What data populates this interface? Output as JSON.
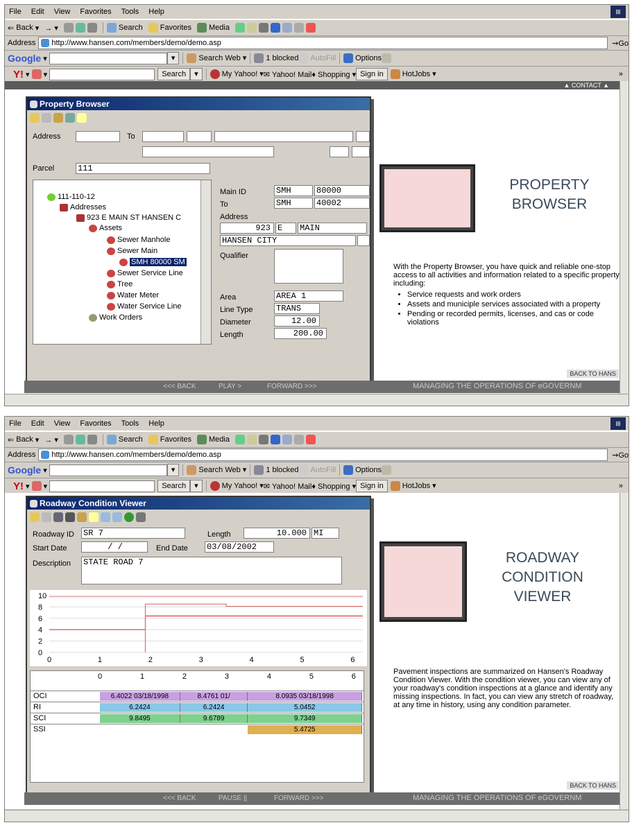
{
  "menu": [
    "File",
    "Edit",
    "View",
    "Favorites",
    "Tools",
    "Help"
  ],
  "toolbar": {
    "back": "Back",
    "search": "Search",
    "favorites": "Favorites",
    "media": "Media"
  },
  "address": {
    "label": "Address",
    "url": "http://www.hansen.com/members/demo/demo.asp",
    "go": "Go"
  },
  "google": {
    "brand": "Google",
    "search_web": "Search Web",
    "blocked": "1 blocked",
    "autofill": "AutoFill",
    "options": "Options"
  },
  "yahoo": {
    "search": "Search",
    "my_yahoo": "My Yahoo!",
    "mail": "Yahoo! Mail",
    "shopping": "Shopping",
    "sign_in": "Sign in",
    "hotjobs": "HotJobs"
  },
  "strip": {
    "contact": "▲ CONTACT ▲",
    "back": "<<< BACK",
    "play": "PLAY >",
    "pause": "PAUSE ||",
    "forward": "FORWARD >>>",
    "managing": "MANAGING THE OPERATIONS OF eGOVERNM",
    "back_to": "BACK TO HANS"
  },
  "property": {
    "title": "Property Browser",
    "address_label": "Address",
    "to_label": "To",
    "parcel_label": "Parcel",
    "parcel_value": "111",
    "tree": [
      "111-110-12",
      "Addresses",
      "923 E MAIN ST HANSEN C",
      "Assets",
      "Sewer Manhole",
      "Sewer Main",
      "SMH 80000 SM",
      "Sewer Service Line",
      "Tree",
      "Water Meter",
      "Water Service Line",
      "Work Orders"
    ],
    "main_id_label": "Main ID",
    "main_id_a": "SMH",
    "main_id_b": "80000",
    "to2_label": "To",
    "to_a": "SMH",
    "to_b": "40002",
    "addr_label": "Address",
    "addr_num": "923",
    "addr_dir": "E",
    "addr_street": "MAIN",
    "city": "HANSEN CITY",
    "qualifier_label": "Qualifier",
    "area_label": "Area",
    "area": "AREA 1",
    "linetype_label": "Line Type",
    "linetype": "TRANS",
    "diameter_label": "Diameter",
    "diameter": "12.00",
    "length_label": "Length",
    "length": "200.00",
    "heading_1": "PROPERTY",
    "heading_2": "BROWSER",
    "intro": "With the Property Browser, you have quick and reliable one-stop access to all activities and information related to a specific property, including:",
    "bullets": [
      "Service requests and work orders",
      "Assets and municiple services associated with a property",
      "Pending or recorded permits, licenses, and cas or code violations"
    ]
  },
  "roadway": {
    "title": "Roadway Condition Viewer",
    "rid_label": "Roadway ID",
    "rid": "SR 7",
    "length_label": "Length",
    "length": "10.000",
    "unit": "MI",
    "start_label": "Start Date",
    "start": "/ /",
    "end_label": "End Date",
    "end": "03/08/2002",
    "desc_label": "Description",
    "desc": "STATE ROAD 7",
    "heading_1": "ROADWAY",
    "heading_2": "CONDITION",
    "heading_3": "VIEWER",
    "text": "Pavement inspections are summarized on Hansen's Roadway Condition Viewer. With the condition viewer, you can view any of your roadway's condition inspections at a glance and identify any missing inspections. In fact, you can view any stretch of roadway, at any time in history, using any condition parameter.",
    "rows": [
      {
        "name": "OCI",
        "cells": [
          {
            "t": "6.4022 03/18/1998",
            "a": 0,
            "b": 1.9,
            "c": "#c8a0e0"
          },
          {
            "t": "8.4761 01/",
            "a": 1.9,
            "b": 3.5,
            "c": "#c8a0e0"
          },
          {
            "t": "8.0935 03/18/1998",
            "a": 3.5,
            "b": 6.2,
            "c": "#c8a0e0"
          }
        ]
      },
      {
        "name": "RI",
        "cells": [
          {
            "t": "6.2424",
            "a": 0,
            "b": 1.9,
            "c": "#88c8e8"
          },
          {
            "t": "6.2424",
            "a": 1.9,
            "b": 3.5,
            "c": "#88c8e8"
          },
          {
            "t": "5.0452",
            "a": 3.5,
            "b": 6.2,
            "c": "#88c8e8"
          }
        ]
      },
      {
        "name": "SCI",
        "cells": [
          {
            "t": "9.8495",
            "a": 0,
            "b": 1.9,
            "c": "#80d090"
          },
          {
            "t": "9.6789",
            "a": 1.9,
            "b": 3.5,
            "c": "#80d090"
          },
          {
            "t": "9.7349",
            "a": 3.5,
            "b": 6.2,
            "c": "#80d090"
          }
        ]
      },
      {
        "name": "SSI",
        "cells": [
          {
            "t": "5.4725",
            "a": 3.5,
            "b": 6.2,
            "c": "#e0b050"
          }
        ]
      }
    ]
  },
  "chart_data": {
    "type": "line",
    "x_ticks": [
      0,
      1,
      2,
      3,
      4,
      5,
      6
    ],
    "y_ticks": [
      0,
      2,
      4,
      6,
      8,
      10
    ],
    "xlim": [
      0,
      6.2
    ],
    "ylim": [
      0,
      10
    ],
    "series": [
      {
        "x": [
          0,
          1.9,
          1.9,
          6.2
        ],
        "y": [
          4,
          4,
          6.4,
          6.4
        ],
        "color": "#e04040"
      },
      {
        "x": [
          1.9,
          1.9,
          3.5,
          3.5,
          6.2
        ],
        "y": [
          0,
          8.5,
          8.5,
          8.1,
          8.1
        ],
        "color": "#e07070"
      },
      {
        "x": [
          0,
          6.2
        ],
        "y": [
          9.8,
          9.8
        ],
        "color": "#e0a0a0"
      }
    ]
  }
}
